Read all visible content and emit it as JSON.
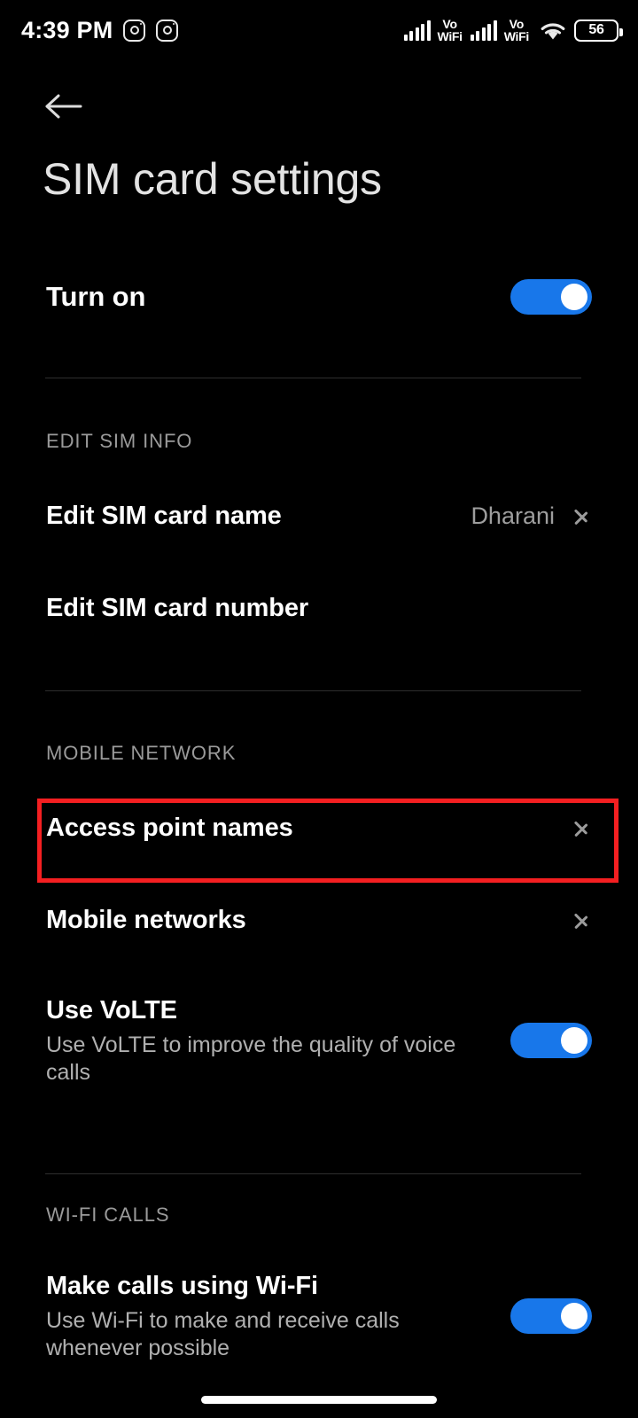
{
  "status_bar": {
    "clock": "4:39 PM",
    "notification_icons": [
      "instagram-icon",
      "instagram-icon"
    ],
    "signal_1": {
      "icon": "signal-bars-icon",
      "bars": 5,
      "label_top": "Vo",
      "label_bottom": "WiFi"
    },
    "signal_2": {
      "icon": "signal-bars-icon",
      "bars": 5,
      "label_top": "Vo",
      "label_bottom": "WiFi"
    },
    "wifi": "wifi-icon",
    "battery_percent": "56"
  },
  "header": {
    "back_icon": "back-arrow-icon",
    "title": "SIM card settings"
  },
  "colors": {
    "background": "#000000",
    "toggle_on": "#1877ea",
    "highlight": "#f41f21",
    "primary_text": "#fefefe",
    "secondary_text": "#b0b0b0",
    "section_header_text": "#9a9a9a",
    "divider": "#2e2e2e"
  },
  "main": {
    "turn_on": {
      "label": "Turn on",
      "toggle_state": "on"
    },
    "sections": [
      {
        "header": "EDIT SIM INFO",
        "items": [
          {
            "label": "Edit SIM card name",
            "value": "Dharani",
            "chevron": true
          },
          {
            "label": "Edit SIM card number",
            "value": "",
            "chevron": false
          }
        ]
      },
      {
        "header": "MOBILE NETWORK",
        "items": [
          {
            "label": "Access point names",
            "chevron": true,
            "highlighted": true
          },
          {
            "label": "Mobile networks",
            "chevron": true
          },
          {
            "label": "Use VoLTE",
            "subtitle": "Use VoLTE to improve the quality of voice calls",
            "toggle_state": "on"
          }
        ]
      },
      {
        "header": "WI-FI CALLS",
        "items": [
          {
            "label": "Make calls using Wi-Fi",
            "subtitle": "Use Wi-Fi to make and receive calls whenever possible",
            "toggle_state": "on"
          }
        ]
      }
    ]
  },
  "navigation": {
    "home_indicator": "home-indicator"
  }
}
